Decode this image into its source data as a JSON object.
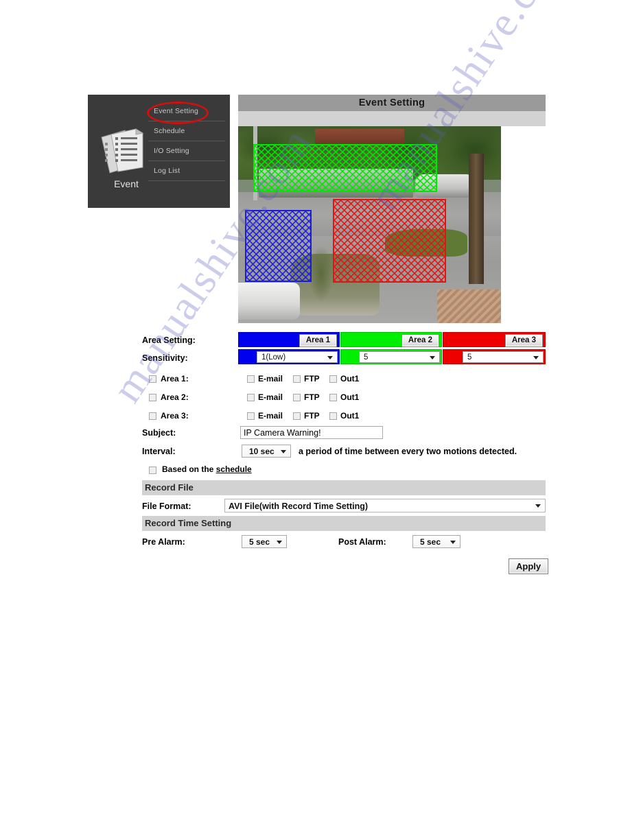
{
  "sidebar": {
    "group_label": "Event",
    "icon": "documents-checklist-icon",
    "highlight_color": "#cc1111",
    "items": [
      {
        "label": "Event Setting",
        "selected": true
      },
      {
        "label": "Schedule",
        "selected": false
      },
      {
        "label": "I/O Setting",
        "selected": false
      },
      {
        "label": "Log List",
        "selected": false
      }
    ]
  },
  "header": {
    "title": "Event Setting"
  },
  "camera": {
    "zones": [
      {
        "name": "Area 1",
        "color": "#0000ee"
      },
      {
        "name": "Area 2",
        "color": "#00ee00"
      },
      {
        "name": "Area 3",
        "color": "#ee0000"
      }
    ]
  },
  "area_setting": {
    "label": "Area Setting:",
    "areas": [
      {
        "button_label": "Area 1",
        "color": "#0000ee"
      },
      {
        "button_label": "Area 2",
        "color": "#00ee00"
      },
      {
        "button_label": "Area 3",
        "color": "#ee0000"
      }
    ]
  },
  "sensitivity": {
    "label": "Sensitivity:",
    "values": [
      "1(Low)",
      "5",
      "5"
    ]
  },
  "notify_rows": [
    {
      "area_label": "Area 1:",
      "area_checked": false,
      "options": [
        {
          "label": "E-mail",
          "checked": false
        },
        {
          "label": "FTP",
          "checked": false
        },
        {
          "label": "Out1",
          "checked": false
        }
      ]
    },
    {
      "area_label": "Area 2:",
      "area_checked": false,
      "options": [
        {
          "label": "E-mail",
          "checked": false
        },
        {
          "label": "FTP",
          "checked": false
        },
        {
          "label": "Out1",
          "checked": false
        }
      ]
    },
    {
      "area_label": "Area 3:",
      "area_checked": false,
      "options": [
        {
          "label": "E-mail",
          "checked": false
        },
        {
          "label": "FTP",
          "checked": false
        },
        {
          "label": "Out1",
          "checked": false
        }
      ]
    }
  ],
  "subject": {
    "label": "Subject:",
    "value": "IP Camera Warning!"
  },
  "interval": {
    "label": "Interval:",
    "value": "10 sec",
    "note": "a period of time between every two motions detected."
  },
  "schedule": {
    "checked": false,
    "text_before": "Based on the ",
    "link_text": "schedule"
  },
  "record_file": {
    "section_title": "Record File",
    "file_format_label": "File Format:",
    "file_format_value": "AVI File(with Record Time Setting)"
  },
  "record_time": {
    "section_title": "Record Time Setting",
    "pre_alarm_label": "Pre Alarm:",
    "pre_alarm_value": "5 sec",
    "post_alarm_label": "Post Alarm:",
    "post_alarm_value": "5 sec"
  },
  "apply_button": {
    "label": "Apply"
  },
  "watermark": {
    "line_a": "manualshive.com",
    "line_b": "manualshive.com"
  }
}
